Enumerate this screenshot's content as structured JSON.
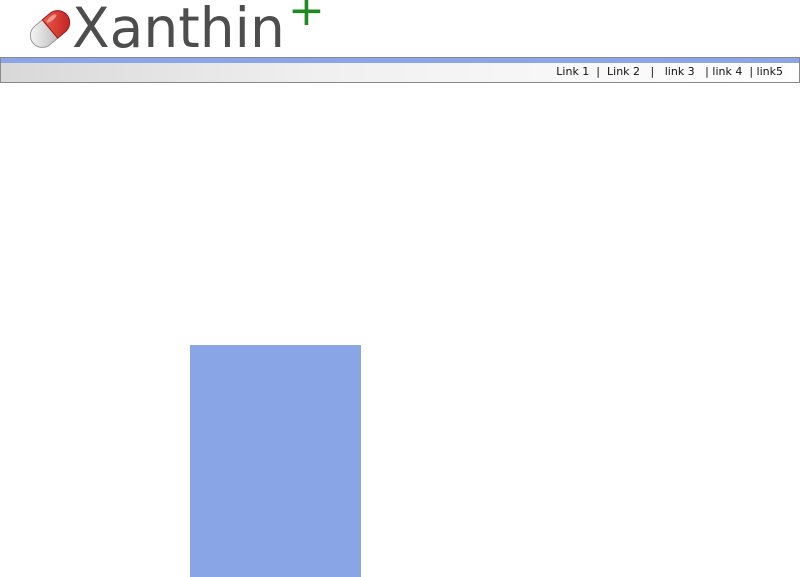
{
  "brand": {
    "name": "Xanthin",
    "plus": "+",
    "text_color": "#4d4d4d",
    "plus_color": "#1f8a1f",
    "pill_icon": "pill-icon"
  },
  "navbar": {
    "stripe_color": "#8ba5e6",
    "links": [
      {
        "label": "Link 1"
      },
      {
        "label": "Link 2"
      },
      {
        "label": "link 3"
      },
      {
        "label": "link 4"
      },
      {
        "label": "link5"
      }
    ],
    "separators": [
      "  |  ",
      "   |   ",
      "   | ",
      "  | "
    ]
  },
  "main": {
    "block_color": "#8aa5e6"
  }
}
